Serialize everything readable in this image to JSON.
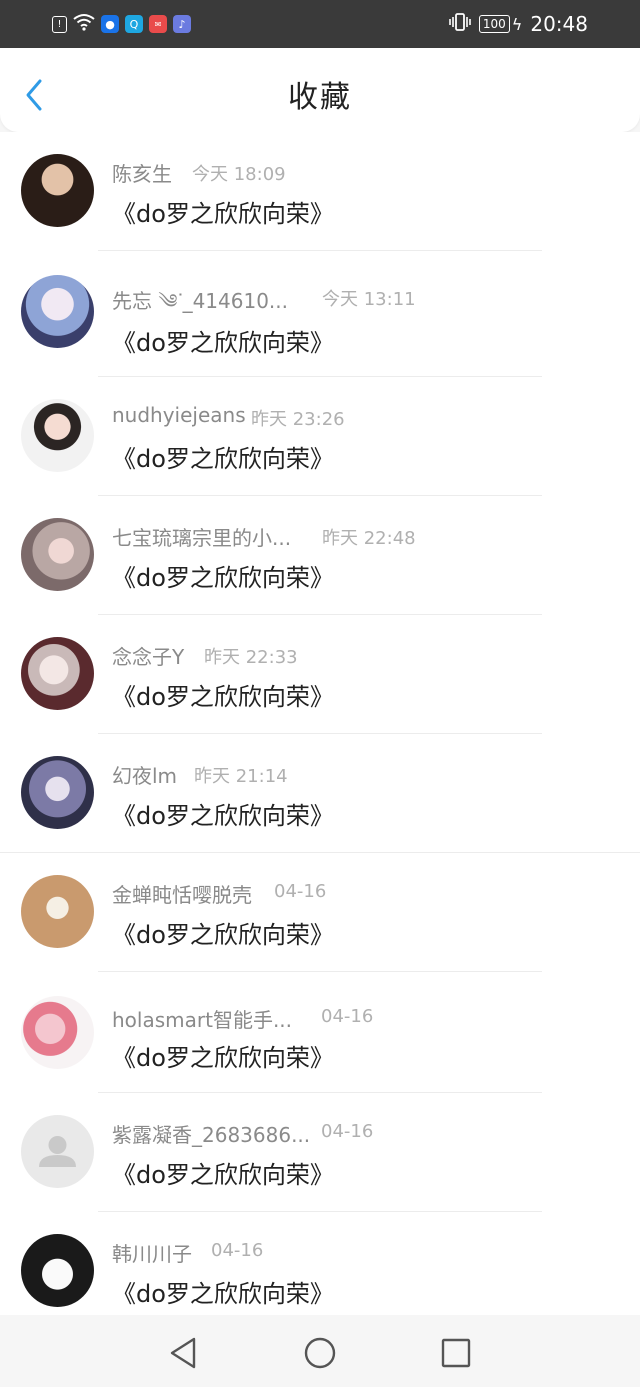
{
  "status_bar": {
    "time": "20:48",
    "battery": "100",
    "left_icons": [
      "alert-icon",
      "wifi-icon",
      "app-blue-icon",
      "app-search-icon",
      "app-red-icon",
      "music-icon"
    ],
    "right_icons": [
      "vibrate-icon",
      "battery-icon",
      "charging-icon"
    ]
  },
  "header": {
    "title": "收藏"
  },
  "items": [
    {
      "name": "陈亥生",
      "time": "今天 18:09",
      "text": "《do罗之欣欣向荣》"
    },
    {
      "name": "先忘 ༄ᐝ_414610...",
      "time": "今天 13:11",
      "text": "《do罗之欣欣向荣》"
    },
    {
      "name": "nudhyiejeans",
      "time": "昨天 23:26",
      "text": "《do罗之欣欣向荣》"
    },
    {
      "name": "七宝琉璃宗里的小...",
      "time": "昨天 22:48",
      "text": "《do罗之欣欣向荣》"
    },
    {
      "name": "念念子Y",
      "time": "昨天 22:33",
      "text": "《do罗之欣欣向荣》"
    },
    {
      "name": "幻夜lm",
      "time": "昨天 21:14",
      "text": "《do罗之欣欣向荣》"
    },
    {
      "name": "金蝉盹恬嘤脱壳",
      "time": "04-16",
      "text": "《do罗之欣欣向荣》"
    },
    {
      "name": "holasmart智能手...",
      "time": "04-16",
      "text": "《do罗之欣欣向荣》"
    },
    {
      "name": "紫露凝香_2683686...",
      "time": "04-16",
      "text": "《do罗之欣欣向荣》"
    },
    {
      "name": "韩川川子",
      "time": "04-16",
      "text": "《do罗之欣欣向荣》"
    }
  ],
  "colors": {
    "accent": "#2f9be6"
  }
}
